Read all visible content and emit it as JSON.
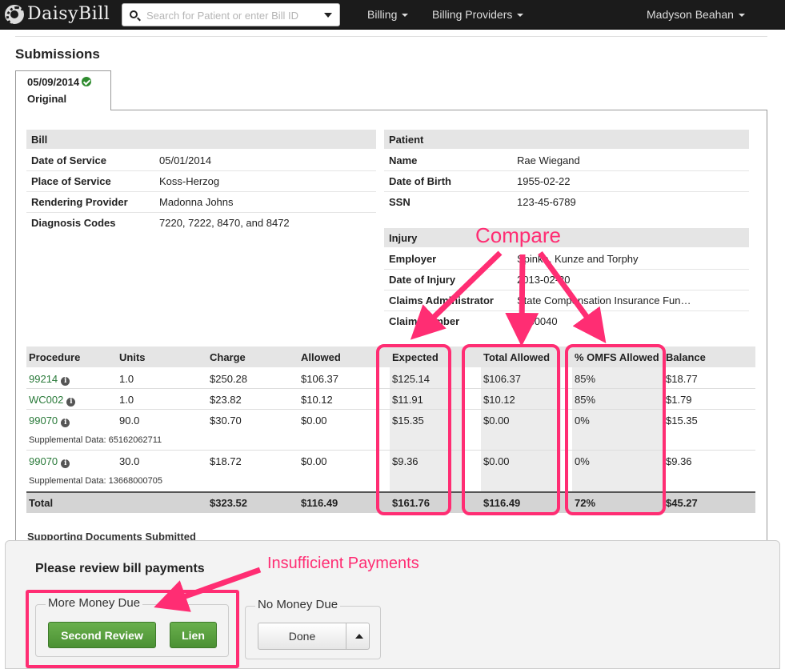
{
  "app": {
    "name": "DaisyBill"
  },
  "search": {
    "placeholder": "Search for Patient or enter Bill ID"
  },
  "nav": {
    "billing": "Billing",
    "billing_providers": "Billing Providers",
    "user": "Madyson Beahan"
  },
  "page": {
    "title": "Submissions"
  },
  "tab": {
    "date": "05/09/2014",
    "type": "Original"
  },
  "bill": {
    "heading": "Bill",
    "rows": [
      {
        "label": "Date of Service",
        "value": "05/01/2014"
      },
      {
        "label": "Place of Service",
        "value": "Koss-Herzog"
      },
      {
        "label": "Rendering Provider",
        "value": "Madonna Johns"
      },
      {
        "label": "Diagnosis Codes",
        "value": "7220, 7222, 8470, and 8472"
      }
    ]
  },
  "patient": {
    "heading": "Patient",
    "rows": [
      {
        "label": "Name",
        "value": "Rae Wiegand"
      },
      {
        "label": "Date of Birth",
        "value": "1955-02-22"
      },
      {
        "label": "SSN",
        "value": "123-45-6789"
      }
    ]
  },
  "injury": {
    "heading": "Injury",
    "rows": [
      {
        "label": "Employer",
        "value": "Spinka, Kunze and Torphy"
      },
      {
        "label": "Date of Injury",
        "value": "2013-02-20"
      },
      {
        "label": "Claims Administrator",
        "value": "State Compensation Insurance Fun…"
      },
      {
        "label": "Claim Number",
        "value": "0930040"
      }
    ]
  },
  "procedures": {
    "headers": [
      "Procedure",
      "Units",
      "Charge",
      "Allowed",
      "Expected",
      "Total Allowed",
      "% OMFS Allowed",
      "Balance"
    ],
    "rows": [
      {
        "code": "99214",
        "units": "1.0",
        "charge": "$250.28",
        "allowed": "$106.37",
        "expected": "$125.14",
        "total_allowed": "$106.37",
        "omfs": "85%",
        "balance": "$18.77",
        "supplemental": ""
      },
      {
        "code": "WC002",
        "units": "1.0",
        "charge": "$23.82",
        "allowed": "$10.12",
        "expected": "$11.91",
        "total_allowed": "$10.12",
        "omfs": "85%",
        "balance": "$1.79",
        "supplemental": ""
      },
      {
        "code": "99070",
        "units": "90.0",
        "charge": "$30.70",
        "allowed": "$0.00",
        "expected": "$15.35",
        "total_allowed": "$0.00",
        "omfs": "0%",
        "balance": "$15.35",
        "supplemental": "Supplemental Data: 65162062711"
      },
      {
        "code": "99070",
        "units": "30.0",
        "charge": "$18.72",
        "allowed": "$0.00",
        "expected": "$9.36",
        "total_allowed": "$0.00",
        "omfs": "0%",
        "balance": "$9.36",
        "supplemental": "Supplemental Data: 13668000705"
      }
    ],
    "total": {
      "label": "Total",
      "charge": "$323.52",
      "allowed": "$116.49",
      "expected": "$161.76",
      "total_allowed": "$116.49",
      "omfs": "72%",
      "balance": "$45.27"
    }
  },
  "supporting_docs": {
    "heading": "Supporting Documents Submitted"
  },
  "review": {
    "title": "Please review bill payments",
    "more_money_due": "More Money Due",
    "second_review": "Second Review",
    "lien": "Lien",
    "no_money_due": "No Money Due",
    "done": "Done"
  },
  "annotations": {
    "compare": "Compare",
    "insufficient": "Insufficient Payments",
    "color": "#ff2d73"
  }
}
